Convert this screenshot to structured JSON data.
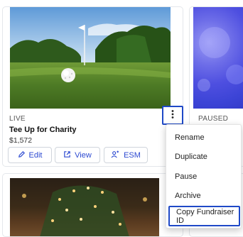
{
  "cards": [
    {
      "status": "LIVE",
      "title": "Tee Up for Charity",
      "amount": "$1,572",
      "buttons": {
        "edit_label": "Edit",
        "view_label": "View",
        "esm_label": "ESM"
      }
    },
    {
      "status": "PAUSED"
    }
  ],
  "context_menu": {
    "items": [
      "Rename",
      "Duplicate",
      "Pause",
      "Archive",
      "Copy Fundraiser ID"
    ]
  },
  "icons": {
    "kebab": "more-vertical-icon",
    "edit": "pencil-icon",
    "view": "external-link-icon",
    "esm": "user-group-icon"
  },
  "colors": {
    "accent": "#2d4ad1",
    "focus_outline": "#1f49c7"
  }
}
